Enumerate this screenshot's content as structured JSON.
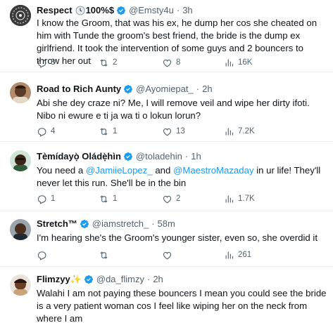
{
  "tweets": [
    {
      "name": "Respect",
      "name_suffix": "100%$",
      "handle": "@Emsty4u",
      "time": "3h",
      "text": "I know the Groom, that was his ex, he dump her cos she cheated on him with Tunde the groom's best friend, the bride is the dump ex girlfriend. It took the intervention of some guys and 2 bouncers to throw her out",
      "replies": "8",
      "retweets": "2",
      "likes": "8",
      "views": "16K"
    },
    {
      "name": "Road to Rich Aunty",
      "handle": "@Ayomiepat_",
      "time": "2h",
      "text": "Abi she dey craze ni? Me, I will remove veil and wipe her dirty ifoti. Nibo ni ewure e ti ja wa ti o lokun lorun?",
      "replies": "4",
      "retweets": "1",
      "likes": "13",
      "views": "7.2K"
    },
    {
      "name": "Tèmídayọ̀ Oládẹ̀hìn",
      "handle": "@toladehin",
      "time": "1h",
      "text_before": "You need a ",
      "mention1": "@JamiieLopez_",
      "text_mid": " and ",
      "mention2": "@MaestroMazaday",
      "text_after": " in ur life! They'll never let this run. She'll be in the bin",
      "replies": "1",
      "retweets": "1",
      "likes": "2",
      "views": "1.7K"
    },
    {
      "name": "Stretch™",
      "handle": "@iamstretch_",
      "time": "58m",
      "text": "I'm hearing she's the Groom's younger sister, even so, she overdid it",
      "replies": "",
      "retweets": "",
      "likes": "",
      "views": "261"
    },
    {
      "name": "Flimzyy✨",
      "handle": "@da_flimzy",
      "time": "2h",
      "text": "Walahi I am not paying these bouncers I mean you could see the bride is a very patient woman cos I feel like wiping her on the neck from where I am"
    }
  ],
  "separator": "·",
  "colors": {
    "verified": "#1d9bf0",
    "muted": "#536471",
    "text": "#0f1419",
    "mention": "#1d9bf0"
  },
  "icons": [
    "reply-icon",
    "retweet-icon",
    "like-icon",
    "views-icon",
    "verified-badge-icon",
    "clock-emoji-icon",
    "sparkles-icon",
    "pleading-face-emoji-icon"
  ]
}
